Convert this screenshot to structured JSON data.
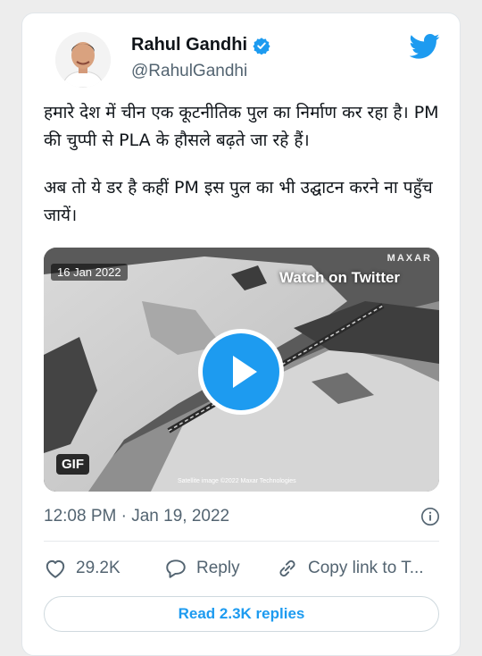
{
  "author": {
    "name": "Rahul Gandhi",
    "handle": "@RahulGandhi",
    "verified": true,
    "avatar_icon": "person-avatar",
    "brand_icon": "twitter-bird-icon"
  },
  "tweet": {
    "paragraphs": [
      "हमारे देश में चीन एक कूटनीतिक पुल का निर्माण कर रहा है। PM की चुप्पी से PLA के हौसले बढ़ते जा रहे हैं।",
      "अब तो ये डर है कहीं PM इस पुल का भी उद्घाटन करने ना पहुँच जायें।"
    ]
  },
  "media": {
    "date_label": "16 Jan 2022",
    "watch_label": "Watch on Twitter",
    "watermark": "MAXAR",
    "badge": "GIF",
    "credit": "Satellite image ©2022 Maxar Technologies",
    "play_icon": "play-icon"
  },
  "meta": {
    "timestamp": "12:08 PM · Jan 19, 2022",
    "info_icon": "info-icon"
  },
  "actions": {
    "like_count": "29.2K",
    "reply_label": "Reply",
    "copy_label": "Copy link to T..."
  },
  "replies_button": "Read 2.3K replies",
  "colors": {
    "accent": "#1d9bf0",
    "text": "#0f1419",
    "secondary_text": "#536471",
    "card_bg": "#ffffff",
    "page_bg": "#ededed"
  }
}
